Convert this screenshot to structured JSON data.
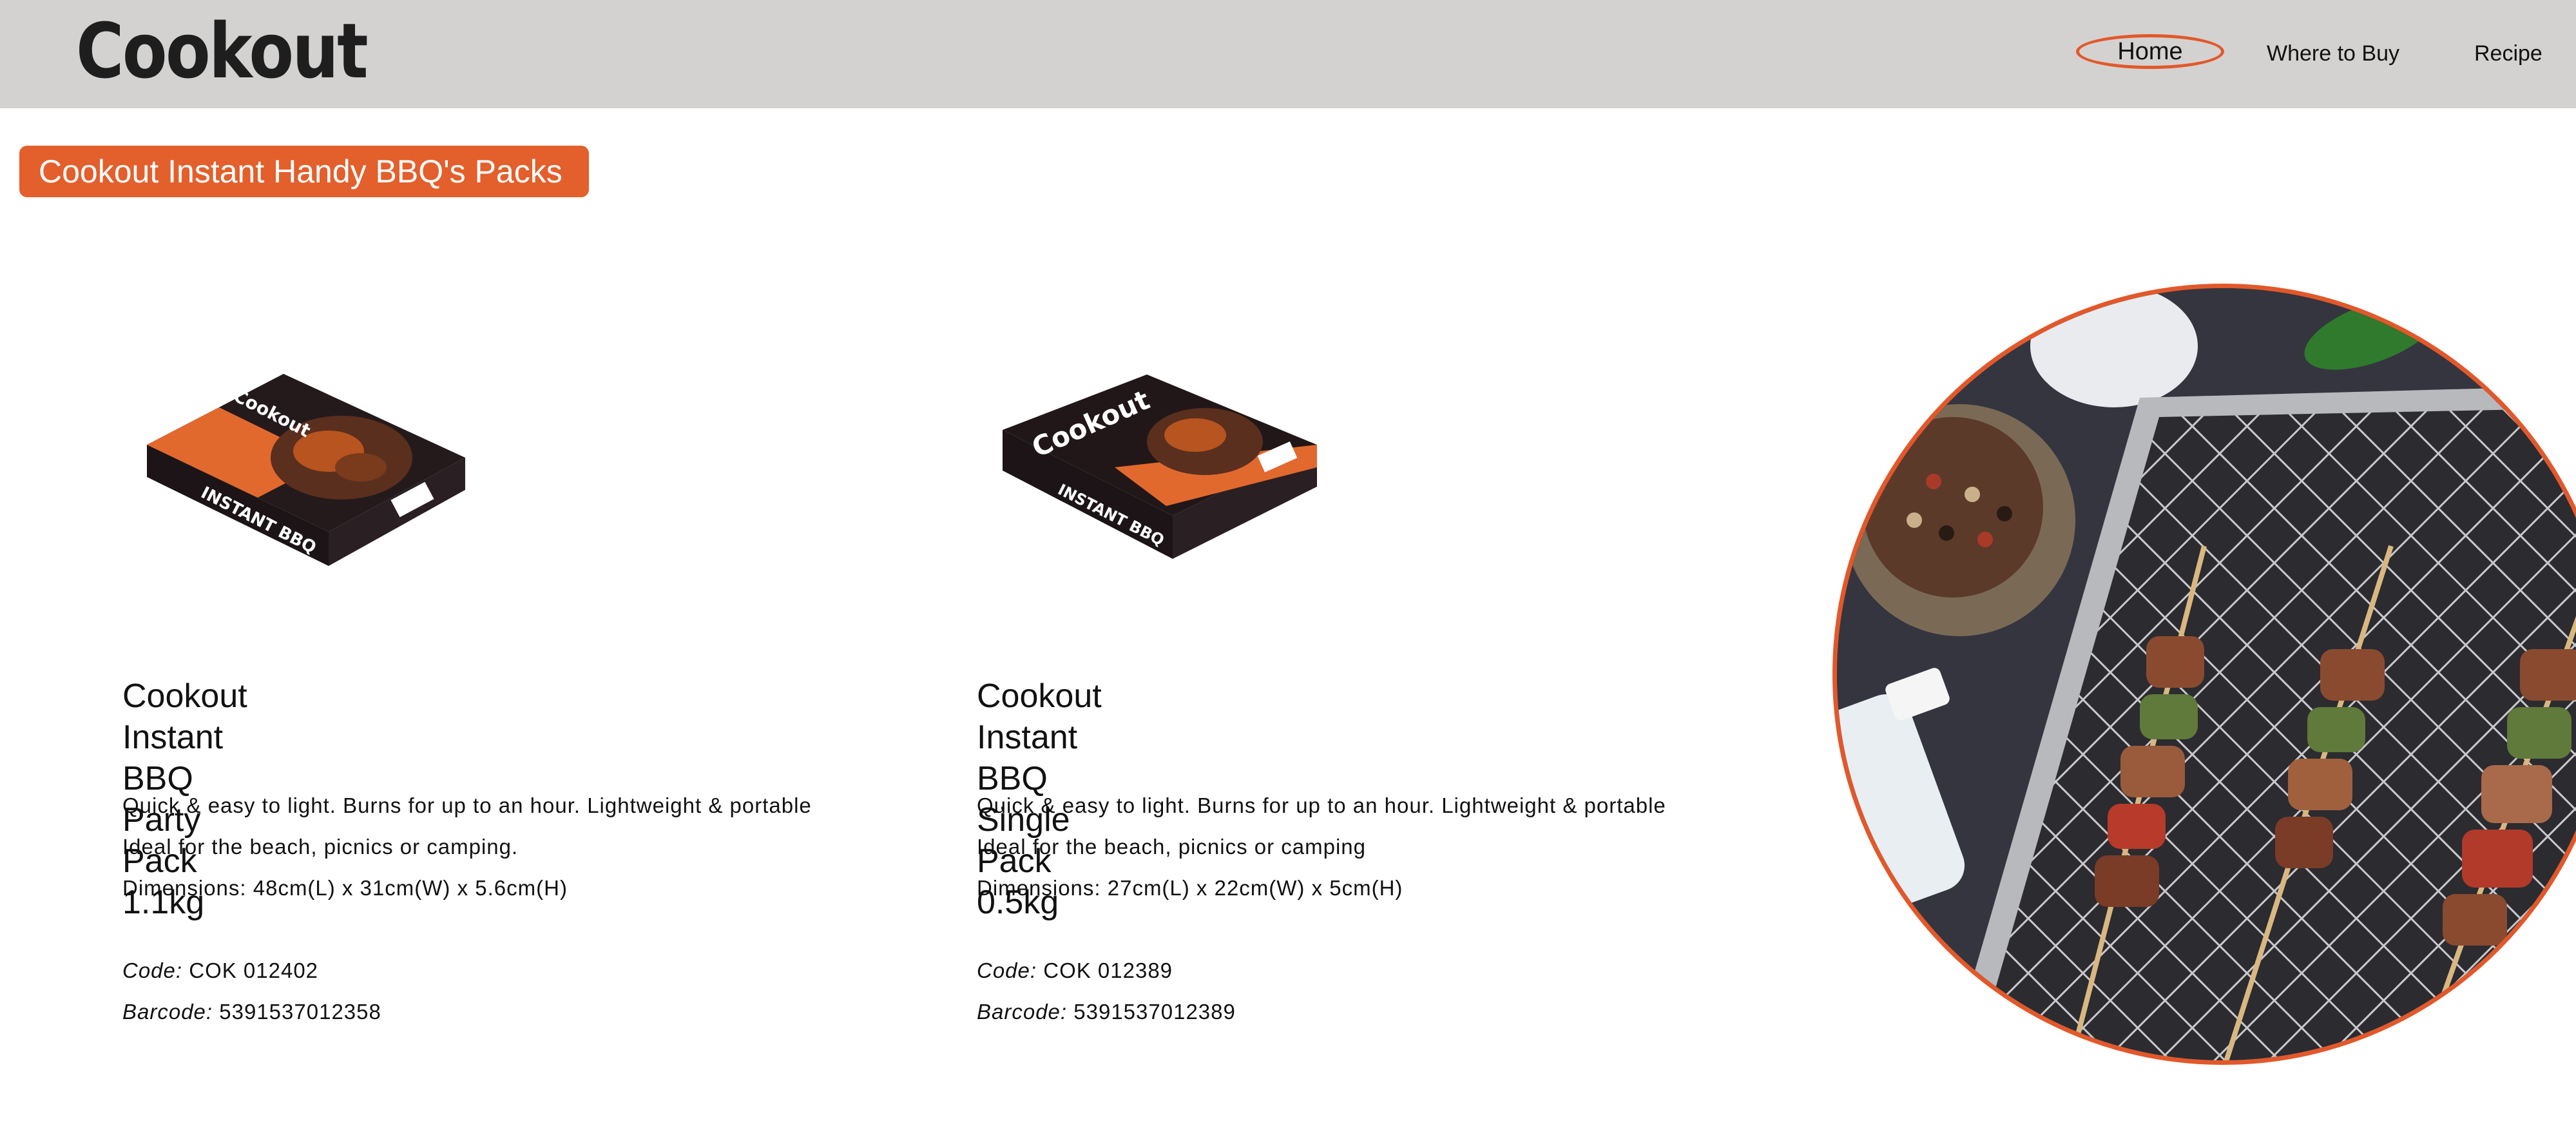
{
  "header": {
    "logo_text": "Cookout",
    "nav": [
      {
        "label": "Home",
        "active": true
      },
      {
        "label": "Where to Buy",
        "active": false
      },
      {
        "label": "Recipe",
        "active": false
      }
    ]
  },
  "page": {
    "badge_title": "Cookout Instant Handy BBQ's Packs"
  },
  "products": [
    {
      "title_line1": "Cookout Instant BBQ",
      "title_line2": "Party Pack 1.1kg",
      "desc_line1": "Quick & easy to light. Burns for up to an hour. Lightweight & portable",
      "desc_line2": "Ideal for the beach, picnics or camping.",
      "desc_line3": "Dimensions: 48cm(L) x 31cm(W) x 5.6cm(H)",
      "code_label": "Code:",
      "code_value": "COK 012402",
      "barcode_label": "Barcode:",
      "barcode_value": "5391537012358",
      "pack_brand": "Cookout",
      "pack_text": "INSTANT BBQ"
    },
    {
      "title_line1": "Cookout Instant BBQ",
      "title_line2": "Single Pack 0.5kg",
      "desc_line1": "Quick & easy to light. Burns for up to an hour. Lightweight & portable",
      "desc_line2": "Ideal for the beach, picnics or camping",
      "desc_line3": "Dimensions: 27cm(L) x 22cm(W) x 5cm(H)",
      "code_label": "Code:",
      "code_value": "COK 012389",
      "barcode_label": "Barcode:",
      "barcode_value": "5391537012389",
      "pack_brand": "Cookout",
      "pack_text": "INSTANT BBQ"
    }
  ],
  "colors": {
    "accent": "#e35f2b",
    "header_bg": "#d3d2d0",
    "text": "#111111"
  },
  "icons": {
    "hero_image": "bbq-skewers-photo",
    "product_image": "instant-bbq-pack-photo"
  }
}
